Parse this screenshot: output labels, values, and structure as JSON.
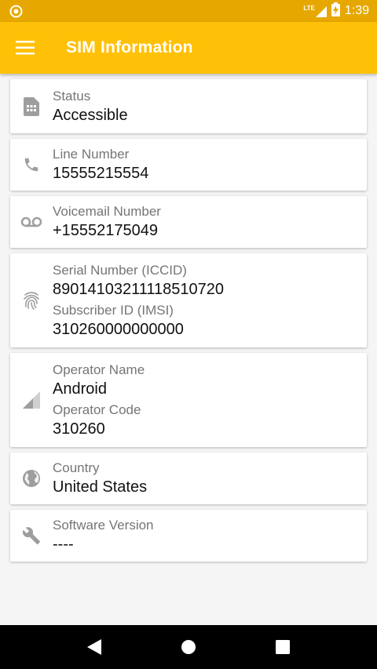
{
  "status_bar": {
    "time": "1:39",
    "network_label": "LTE"
  },
  "app_bar": {
    "title": "SIM Information"
  },
  "cards": {
    "status": {
      "label": "Status",
      "value": "Accessible",
      "icon": "sim-card-icon"
    },
    "line": {
      "label": "Line Number",
      "value": "15555215554",
      "icon": "phone-icon"
    },
    "voicemail": {
      "label": "Voicemail Number",
      "value": "+15552175049",
      "icon": "voicemail-icon"
    },
    "serial": {
      "label": "Serial Number (ICCID)",
      "value": "89014103211118510720",
      "label2": "Subscriber ID (IMSI)",
      "value2": "310260000000000",
      "icon": "fingerprint-icon"
    },
    "operator": {
      "label": "Operator Name",
      "value": "Android",
      "label2": "Operator Code",
      "value2": "310260",
      "icon": "signal-icon"
    },
    "country": {
      "label": "Country",
      "value": "United States",
      "icon": "globe-icon"
    },
    "software": {
      "label": "Software Version",
      "value": "----",
      "icon": "wrench-icon"
    }
  },
  "colors": {
    "accent": "#FFC107",
    "status_bar": "#E6A800",
    "icon": "#9E9E9E"
  }
}
